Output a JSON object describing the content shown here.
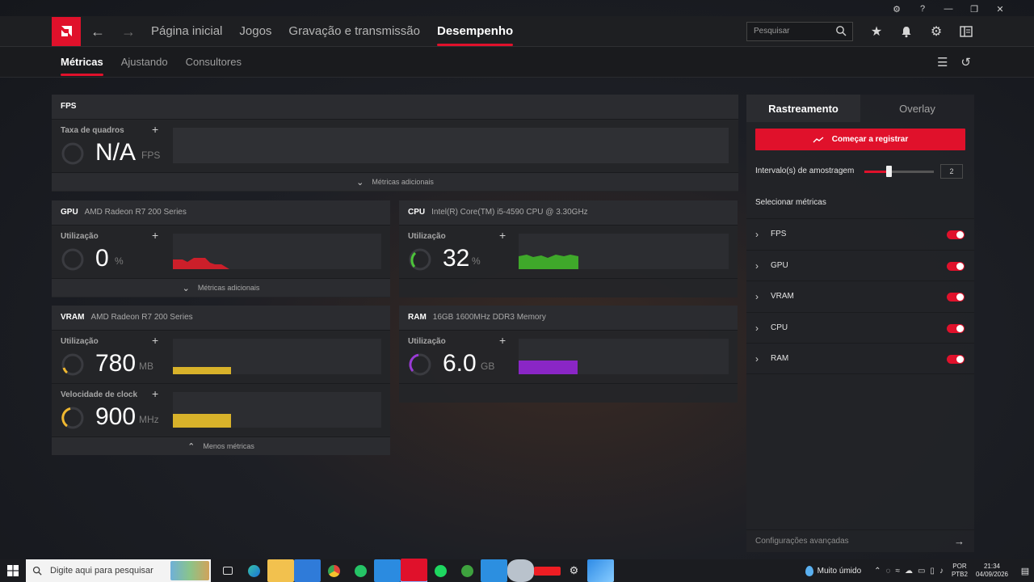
{
  "window_controls": [
    "⚙",
    "?",
    "—",
    "❐",
    "✕"
  ],
  "nav": {
    "back": "←",
    "forward": "→",
    "items": [
      {
        "label": "Página inicial"
      },
      {
        "label": "Jogos"
      },
      {
        "label": "Gravação e transmissão"
      },
      {
        "label": "Desempenho"
      }
    ],
    "active": "Desempenho"
  },
  "search": {
    "placeholder": "Pesquisar"
  },
  "subnav": {
    "items": [
      {
        "label": "Métricas"
      },
      {
        "label": "Ajustando"
      },
      {
        "label": "Consultores"
      }
    ],
    "active": "Métricas"
  },
  "fps_panel": {
    "title": "FPS",
    "metric_label": "Taxa de quadros",
    "value": "N/A",
    "unit": "FPS",
    "expander": "Métricas adicionais"
  },
  "gpu_panel": {
    "title": "GPU",
    "device": "AMD Radeon R7 200 Series",
    "metric_label": "Utilização",
    "value": "0",
    "unit": "%",
    "expander": "Métricas adicionais"
  },
  "cpu_panel": {
    "title": "CPU",
    "device": "Intel(R) Core(TM) i5-4590 CPU @ 3.30GHz",
    "metric_label": "Utilização",
    "value": "32",
    "unit": "%"
  },
  "vram_panel": {
    "title": "VRAM",
    "device": "AMD Radeon R7 200 Series",
    "metric1_label": "Utilização",
    "metric1_value": "780",
    "metric1_unit": "MB",
    "metric2_label": "Velocidade de clock",
    "metric2_value": "900",
    "metric2_unit": "MHz",
    "expander": "Menos métricas"
  },
  "ram_panel": {
    "title": "RAM",
    "device": "16GB 1600MHz DDR3 Memory",
    "metric_label": "Utilização",
    "value": "6.0",
    "unit": "GB"
  },
  "tracking": {
    "tabs": [
      {
        "label": "Rastreamento"
      },
      {
        "label": "Overlay"
      }
    ],
    "active_tab": "Rastreamento",
    "record_button": "Começar a registrar",
    "interval_label": "Intervalo(s) de amostragem",
    "interval_value": "2",
    "interval_slider_fraction": 0.35,
    "select_label": "Selecionar métricas",
    "metrics": [
      {
        "name": "FPS",
        "enabled": true
      },
      {
        "name": "GPU",
        "enabled": true
      },
      {
        "name": "VRAM",
        "enabled": true
      },
      {
        "name": "CPU",
        "enabled": true
      },
      {
        "name": "RAM",
        "enabled": true
      }
    ],
    "advanced": "Configurações avançadas"
  },
  "taskbar": {
    "search_placeholder": "Digite aqui para pesquisar",
    "weather": "Muito úmido",
    "lang_line1": "POR",
    "lang_line2": "PTB2",
    "time": "21:34",
    "date": "04/09/2026"
  },
  "colors": {
    "accent": "#e0112b",
    "gpu_graph": "#cc1f2a",
    "cpu_graph": "#3fa82a",
    "cpu_gauge": "#4cc43a",
    "vram_graph": "#d8b22a",
    "vram_gauge": "#f0b830",
    "ram_graph": "#8a26c6",
    "ram_gauge": "#9a3ad6"
  }
}
